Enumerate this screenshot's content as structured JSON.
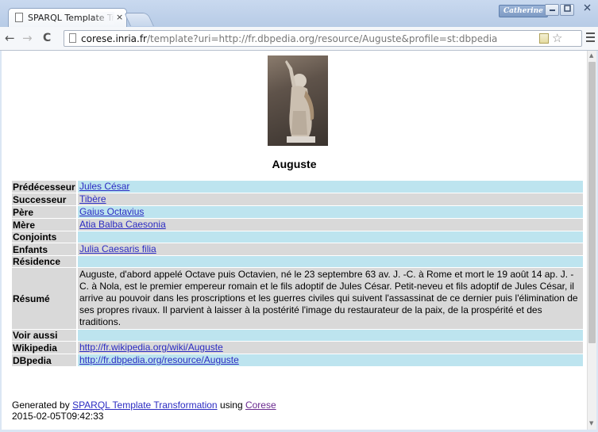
{
  "browser": {
    "tab_title": "SPARQL Template Tr",
    "tab_close": "×",
    "user": "Catherine",
    "url_host": "corese.inria.fr",
    "url_path": "/template?uri=http://fr.dbpedia.org/resource/Auguste&profile=st:dbpedia",
    "nav": {
      "back": "←",
      "forward": "→",
      "reload": "C"
    },
    "window_controls": {
      "minimize": "—",
      "maximize": "□",
      "close": "✕"
    }
  },
  "page": {
    "heading": "Auguste",
    "rows": [
      {
        "label": "Prédécesseur",
        "value": "Jules César",
        "link": true
      },
      {
        "label": "Successeur",
        "value": "Tibère",
        "link": true
      },
      {
        "label": "Père",
        "value": "Gaius Octavius",
        "link": true
      },
      {
        "label": "Mère",
        "value": "Atia Balba Caesonia",
        "link": true
      },
      {
        "label": "Conjoints",
        "value": "",
        "link": false
      },
      {
        "label": "Enfants",
        "value": "Julia Caesaris filia",
        "link": true
      },
      {
        "label": "Résidence",
        "value": "",
        "link": false
      },
      {
        "label": "Résumé",
        "value": "Auguste, d'abord appelé Octave puis Octavien, né le 23 septembre 63 av. J. -C. à Rome et mort le 19 août 14 ap. J. -C. à Nola, est le premier empereur romain et le fils adoptif de Jules César. Petit-neveu et fils adoptif de Jules César, il arrive au pouvoir dans les proscriptions et les guerres civiles qui suivent l'assassinat de ce dernier puis l'élimination de ses propres rivaux. Il parvient à laisser à la postérité l'image du restaurateur de la paix, de la prospérité et des traditions.",
        "link": false
      },
      {
        "label": "Voir aussi",
        "value": "",
        "link": false
      },
      {
        "label": "Wikipedia",
        "value": "http://fr.wikipedia.org/wiki/Auguste",
        "link": true
      },
      {
        "label": "DBpedia",
        "value": "http://fr.dbpedia.org/resource/Auguste",
        "link": true
      }
    ],
    "footer": {
      "generated_by": "Generated by",
      "tool_link": "SPARQL Template Transformation",
      "using": "using",
      "engine_link": "Corese",
      "timestamp": "2015-02-05T09:42:33"
    }
  }
}
